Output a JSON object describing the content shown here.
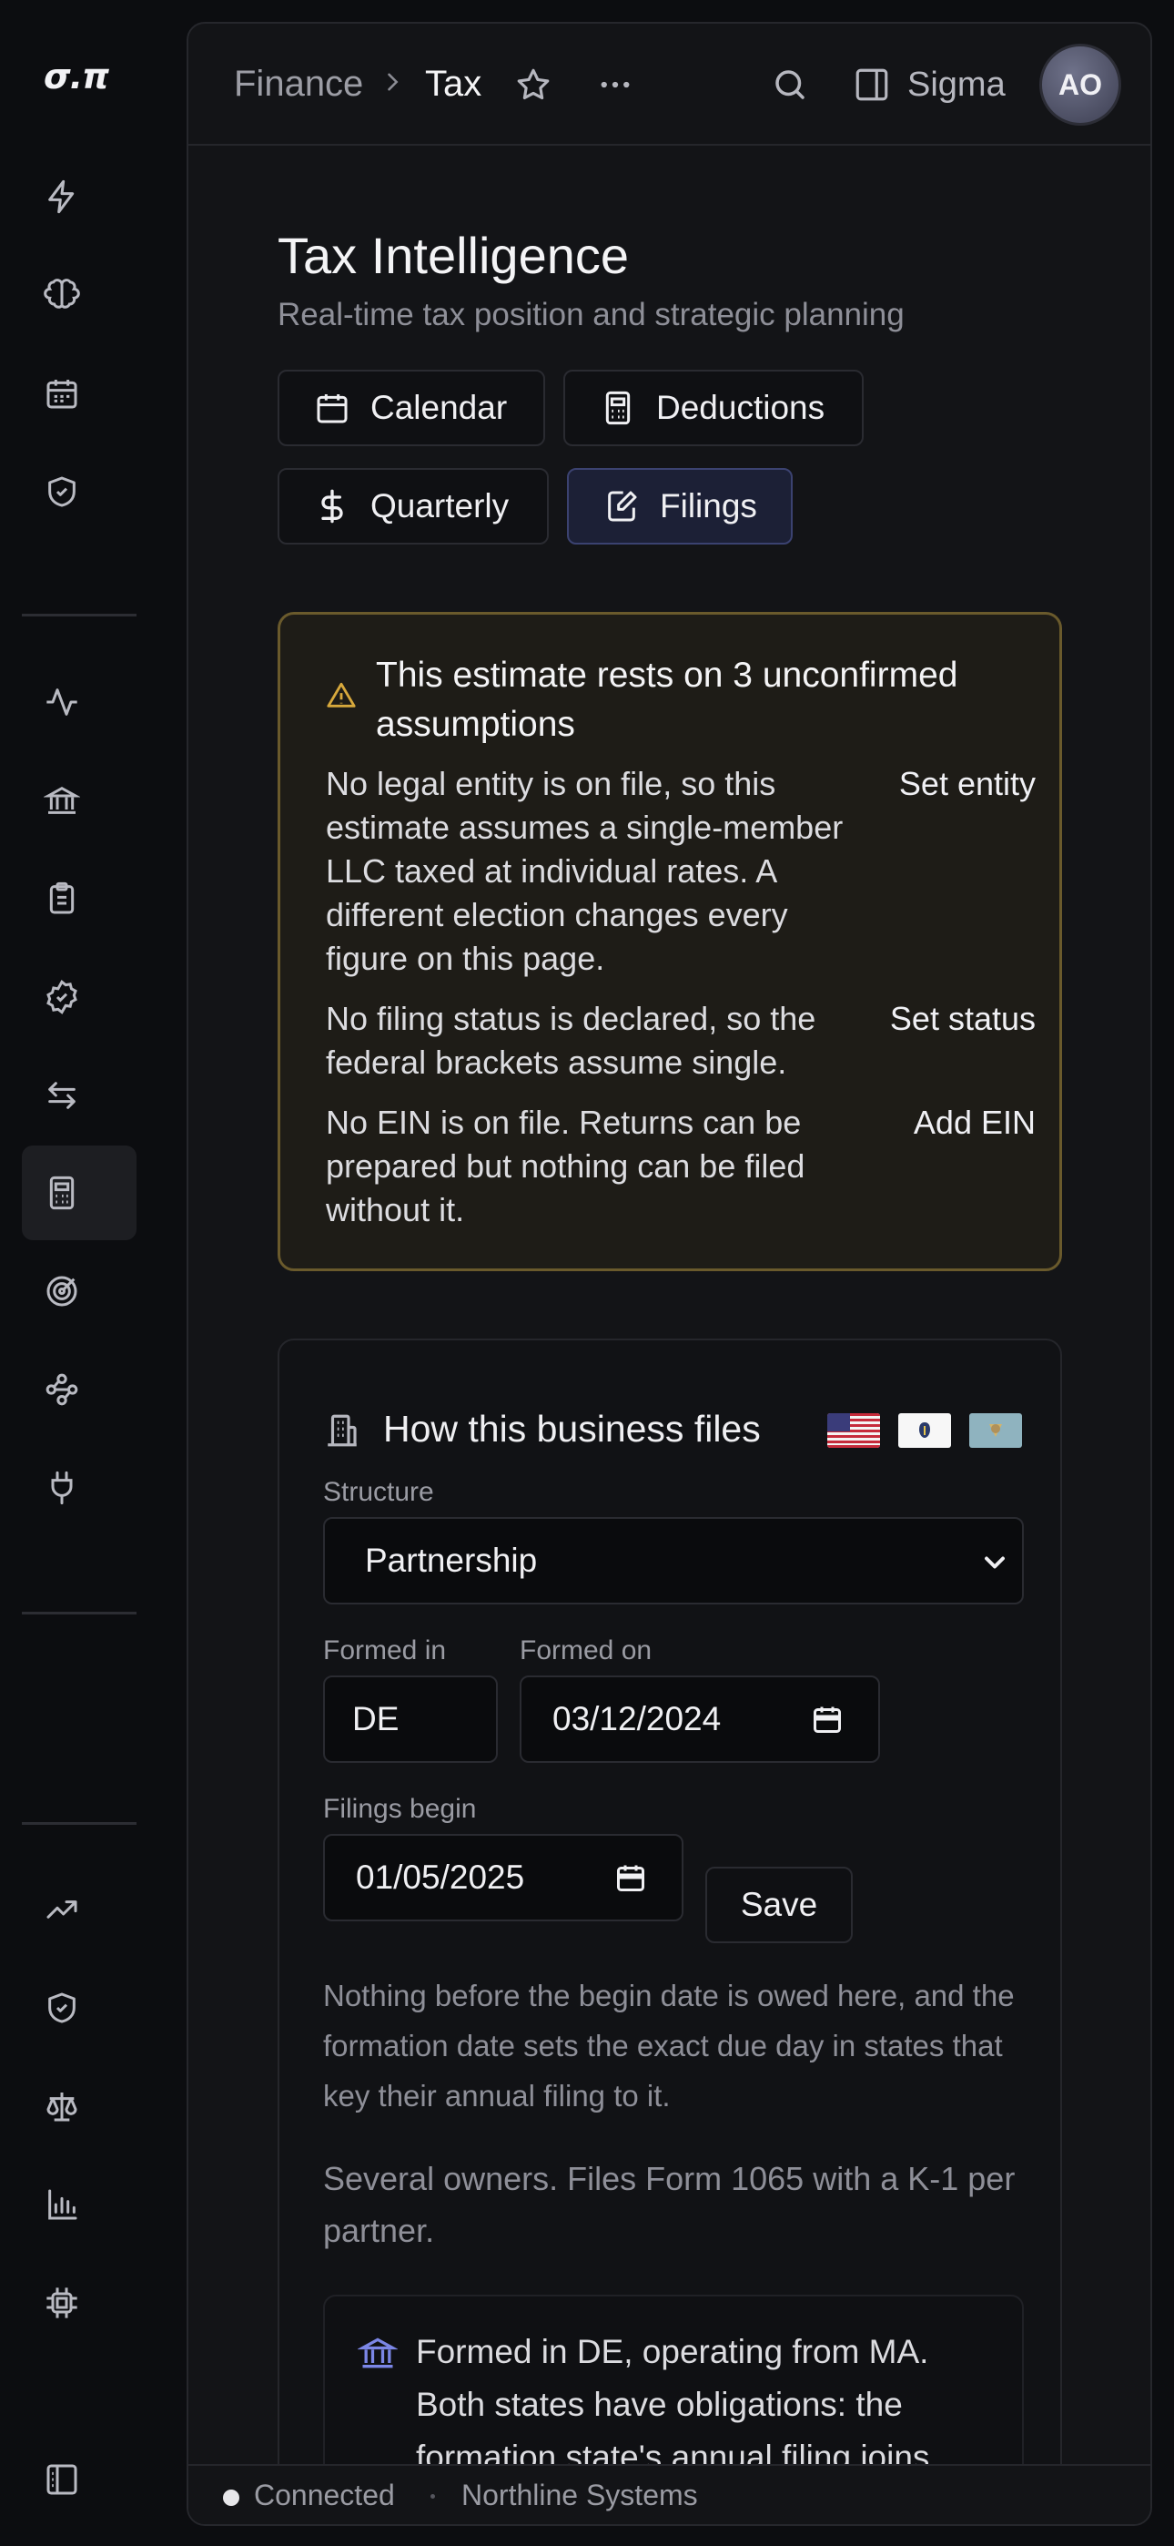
{
  "app": {
    "logo": "σ.π"
  },
  "rail": {
    "items": [
      {
        "name": "bolt-icon"
      },
      {
        "name": "brain-icon"
      },
      {
        "name": "calendar-icon"
      },
      {
        "name": "shield-check-icon"
      },
      {
        "name": "activity-icon"
      },
      {
        "name": "bank-icon"
      },
      {
        "name": "clipboard-icon"
      },
      {
        "name": "badge-check-icon"
      },
      {
        "name": "arrows-swap-icon"
      },
      {
        "name": "calculator-icon",
        "active": true
      },
      {
        "name": "target-icon"
      },
      {
        "name": "workflow-icon"
      },
      {
        "name": "plug-icon"
      },
      {
        "name": "trending-up-icon"
      },
      {
        "name": "shield-icon"
      },
      {
        "name": "scale-icon"
      },
      {
        "name": "bar-chart-icon"
      },
      {
        "name": "chip-icon"
      },
      {
        "name": "sidebar-toggle-icon"
      }
    ]
  },
  "header": {
    "breadcrumb_parent": "Finance",
    "breadcrumb_current": "Tax",
    "workspace": "Sigma",
    "avatar_initials": "AO"
  },
  "page": {
    "title": "Tax Intelligence",
    "subtitle": "Real-time tax position and strategic planning"
  },
  "tabs": [
    {
      "label": "Calendar",
      "icon": "calendar-icon"
    },
    {
      "label": "Deductions",
      "icon": "calculator-icon"
    },
    {
      "label": "Quarterly",
      "icon": "dollar-icon"
    },
    {
      "label": "Filings",
      "icon": "edit-doc-icon",
      "active": true
    }
  ],
  "warning": {
    "title": "This estimate rests on 3 unconfirmed assumptions",
    "items": [
      {
        "text": "No legal entity is on file, so this estimate assumes a single-member LLC taxed at individual rates. A different election changes every figure on this page.",
        "action": "Set entity"
      },
      {
        "text": "No filing status is declared, so the federal brackets assume single.",
        "action": "Set status"
      },
      {
        "text": "No EIN is on file. Returns can be prepared but nothing can be filed without it.",
        "action": "Add EIN"
      }
    ],
    "accent": "#d8a93c"
  },
  "filing_card": {
    "title": "How this business files",
    "flags": [
      "us-flag",
      "massachusetts-flag",
      "delaware-flag"
    ],
    "structure_label": "Structure",
    "structure_value": "Partnership",
    "formed_in_label": "Formed in",
    "formed_in_value": "DE",
    "formed_on_label": "Formed on",
    "formed_on_value": "03/12/2024",
    "filings_begin_label": "Filings begin",
    "filings_begin_value": "01/05/2025",
    "save_label": "Save",
    "note": "Nothing before the begin date is owed here, and the formation date sets the exact due day in states that key their annual filing to it.",
    "description": "Several owners. Files Form 1065 with a K-1 per partner.",
    "state_note": "Formed in DE, operating from MA. Both states have obligations: the formation state's annual filing joins"
  },
  "status": {
    "connection": "Connected",
    "company": "Northline Systems"
  }
}
